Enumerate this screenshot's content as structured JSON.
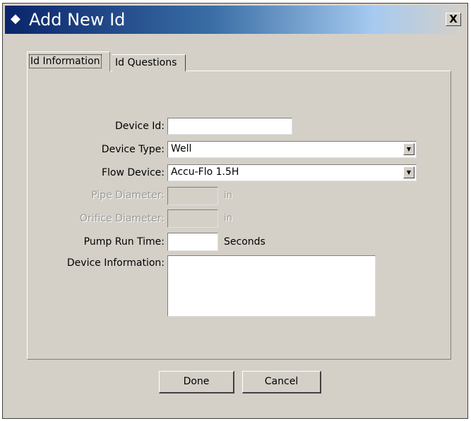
{
  "window": {
    "title": "Add New Id",
    "close_label": "X"
  },
  "tabs": [
    {
      "label": "Id Information"
    },
    {
      "label": "Id Questions"
    }
  ],
  "form": {
    "device_id": {
      "label": "Device Id:",
      "value": ""
    },
    "device_type": {
      "label": "Device Type:",
      "value": "Well"
    },
    "flow_device": {
      "label": "Flow Device:",
      "value": "Accu-Flo 1.5H"
    },
    "pipe_diameter": {
      "label": "Pipe Diameter:",
      "unit": "in",
      "value": ""
    },
    "orifice_diameter": {
      "label": "Orifice Diameter:",
      "unit": "in",
      "value": ""
    },
    "pump_run_time": {
      "label": "Pump Run Time:",
      "unit": "Seconds",
      "value": ""
    },
    "device_information": {
      "label": "Device Information:",
      "value": ""
    }
  },
  "buttons": {
    "done": "Done",
    "cancel": "Cancel"
  },
  "icons": {
    "title": "app-diamond-icon",
    "close": "close-icon",
    "dropdown": "chevron-down-icon"
  }
}
